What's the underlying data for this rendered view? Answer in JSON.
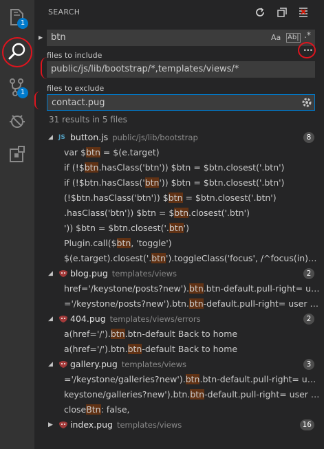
{
  "sidebar": {
    "title": "SEARCH"
  },
  "activity": {
    "explorer_badge": "1",
    "scm_badge": "1"
  },
  "search": {
    "query": "btn",
    "match_case_label": "Aa",
    "match_word_label": "Ab|",
    "regex_label": ".*",
    "more_label": "...",
    "include_label": "files to include",
    "include_value": "public/js/lib/bootstrap/*,templates/views/*",
    "exclude_label": "files to exclude",
    "exclude_value": "contact.pug",
    "summary": "31 results in 5 files"
  },
  "results": [
    {
      "name": "button.js",
      "path": "public/js/lib/bootstrap",
      "icon": "js-icon",
      "count": "8",
      "matches": [
        [
          {
            "t": "var $"
          },
          {
            "t": "btn",
            "h": true
          },
          {
            "t": " = $(e.target)"
          }
        ],
        [
          {
            "t": "if (!$"
          },
          {
            "t": "btn",
            "h": true
          },
          {
            "t": ".hasClass('btn')) $btn = $btn.closest('.btn')"
          }
        ],
        [
          {
            "t": "if (!$btn.hasClass('"
          },
          {
            "t": "btn",
            "h": true
          },
          {
            "t": "')) $btn = $btn.closest('.btn')"
          }
        ],
        [
          {
            "t": "(!$btn.hasClass('btn')) $"
          },
          {
            "t": "btn",
            "h": true
          },
          {
            "t": " = $btn.closest('.btn')"
          }
        ],
        [
          {
            "t": ".hasClass('btn')) $btn = $"
          },
          {
            "t": "btn",
            "h": true
          },
          {
            "t": ".closest('.btn')"
          }
        ],
        [
          {
            "t": "')) $btn = $btn.closest('."
          },
          {
            "t": "btn",
            "h": true
          },
          {
            "t": "')"
          }
        ],
        [
          {
            "t": "Plugin.call($"
          },
          {
            "t": "btn",
            "h": true
          },
          {
            "t": ", 'toggle')"
          }
        ],
        [
          {
            "t": "$(e.target).closest('."
          },
          {
            "t": "btn",
            "h": true
          },
          {
            "t": "').toggleClass('focus', /^focus(in)?$/.te..."
          }
        ]
      ]
    },
    {
      "name": "blog.pug",
      "path": "templates/views",
      "icon": "pug-icon",
      "count": "2",
      "matches": [
        [
          {
            "t": "href='/keystone/posts?new')."
          },
          {
            "t": "btn",
            "h": true
          },
          {
            "t": ".btn-default.pull-right= user ..."
          }
        ],
        [
          {
            "t": "='/keystone/posts?new').btn."
          },
          {
            "t": "btn",
            "h": true
          },
          {
            "t": "-default.pull-right= user ? 'Wr..."
          }
        ]
      ]
    },
    {
      "name": "404.pug",
      "path": "templates/views/errors",
      "icon": "pug-icon",
      "count": "2",
      "matches": [
        [
          {
            "t": "a(href='/')."
          },
          {
            "t": "btn",
            "h": true
          },
          {
            "t": ".btn-default Back to home"
          }
        ],
        [
          {
            "t": "a(href='/').btn."
          },
          {
            "t": "btn",
            "h": true
          },
          {
            "t": "-default Back to home"
          }
        ]
      ]
    },
    {
      "name": "gallery.pug",
      "path": "templates/views",
      "icon": "pug-icon",
      "count": "3",
      "matches": [
        [
          {
            "t": "='/keystone/galleries?new')."
          },
          {
            "t": "btn",
            "h": true
          },
          {
            "t": ".btn-default.pull-right= user ? ..."
          }
        ],
        [
          {
            "t": "keystone/galleries?new').btn."
          },
          {
            "t": "btn",
            "h": true
          },
          {
            "t": "-default.pull-right= user ? 'Ad..."
          }
        ],
        [
          {
            "t": "close"
          },
          {
            "t": "Btn",
            "h": true
          },
          {
            "t": ": false,"
          }
        ]
      ]
    },
    {
      "name": "index.pug",
      "path": "templates/views",
      "icon": "pug-icon",
      "count": "16",
      "collapsed": true,
      "matches": []
    }
  ],
  "colors": {
    "highlight": "#613214",
    "badge": "#007acc",
    "annotation": "#e0141e"
  }
}
